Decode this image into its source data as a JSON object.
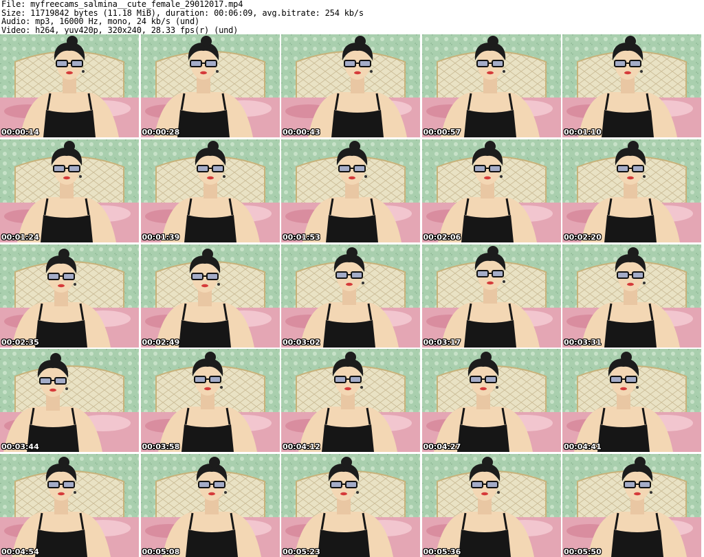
{
  "header": {
    "file_line": "File: myfreecams_salmina__cute_female_29012017.mp4",
    "size_line": "Size: 11719842 bytes (11.18 MiB), duration: 00:06:09, avg.bitrate: 254 kb/s",
    "audio_line": "Audio: mp3, 16000 Hz, mono, 24 kb/s (und)",
    "video_line": "Video: h264, yuv420p, 320x240, 28.33 fps(r) (und)"
  },
  "colors": {
    "background": "#ffffff",
    "header_text": "#000000",
    "wall_green": "#a9cfae",
    "headboard": "#e9e2c4",
    "skin": "#f3d7b4",
    "top_black": "#161616",
    "hair": "#1c1c1c",
    "lips": "#d53a3a",
    "bedding_pink": "#e4a6b4",
    "timestamp_text": "#ffffff"
  },
  "thumbnails": [
    {
      "timestamp": "00:00:14"
    },
    {
      "timestamp": "00:00:28"
    },
    {
      "timestamp": "00:00:43"
    },
    {
      "timestamp": "00:00:57"
    },
    {
      "timestamp": "00:01:10"
    },
    {
      "timestamp": "00:01:24"
    },
    {
      "timestamp": "00:01:39"
    },
    {
      "timestamp": "00:01:53"
    },
    {
      "timestamp": "00:02:06"
    },
    {
      "timestamp": "00:02:20"
    },
    {
      "timestamp": "00:02:35"
    },
    {
      "timestamp": "00:02:49"
    },
    {
      "timestamp": "00:03:02"
    },
    {
      "timestamp": "00:03:17"
    },
    {
      "timestamp": "00:03:31"
    },
    {
      "timestamp": "00:03:44"
    },
    {
      "timestamp": "00:03:58"
    },
    {
      "timestamp": "00:04:12"
    },
    {
      "timestamp": "00:04:27"
    },
    {
      "timestamp": "00:04:41"
    },
    {
      "timestamp": "00:04:54"
    },
    {
      "timestamp": "00:05:08"
    },
    {
      "timestamp": "00:05:23"
    },
    {
      "timestamp": "00:05:36"
    },
    {
      "timestamp": "00:05:50"
    }
  ]
}
